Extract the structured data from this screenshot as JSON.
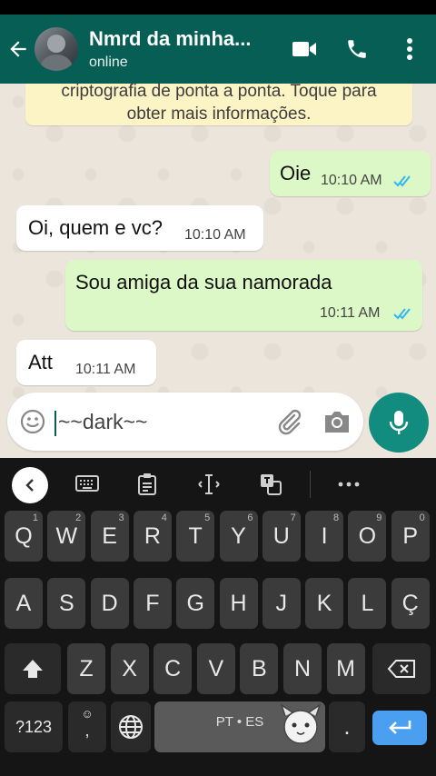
{
  "header": {
    "contact_name": "Nmrd da minha...",
    "contact_status": "online"
  },
  "encryption_notice": {
    "line1": "criptografia de ponta a ponta. Toque para",
    "line2": "obter mais informações."
  },
  "messages": [
    {
      "direction": "outgoing",
      "text": "Oie",
      "time": "10:10 AM",
      "read": true
    },
    {
      "direction": "incoming",
      "text": "Oi, quem e vc?",
      "time": "10:10 AM"
    },
    {
      "direction": "outgoing",
      "text": "Sou amiga da sua namorada",
      "time": "10:11 AM",
      "read": true
    },
    {
      "direction": "incoming",
      "text": "Att",
      "time": "10:11 AM"
    }
  ],
  "composer": {
    "draft_text": "~~dark~~"
  },
  "keyboard": {
    "row1": [
      {
        "label": "Q",
        "hint": "1"
      },
      {
        "label": "W",
        "hint": "2"
      },
      {
        "label": "E",
        "hint": "3"
      },
      {
        "label": "R",
        "hint": "4"
      },
      {
        "label": "T",
        "hint": "5"
      },
      {
        "label": "Y",
        "hint": "6"
      },
      {
        "label": "U",
        "hint": "7"
      },
      {
        "label": "I",
        "hint": "8"
      },
      {
        "label": "O",
        "hint": "9"
      },
      {
        "label": "P",
        "hint": "0"
      }
    ],
    "row2": [
      "A",
      "S",
      "D",
      "F",
      "G",
      "H",
      "J",
      "K",
      "L",
      "Ç"
    ],
    "row3": [
      "Z",
      "X",
      "C",
      "V",
      "B",
      "N",
      "M"
    ],
    "symbols_label": "?123",
    "comma_label": ",",
    "space_label": "PT • ES",
    "period_label": "."
  },
  "colors": {
    "header": "#075e54",
    "outgoing_bubble": "#dcf8c6",
    "incoming_bubble": "#ffffff",
    "read_ticks": "#34b7f1",
    "mic_button": "#128c7e",
    "enter_key": "#4a9ff0"
  }
}
